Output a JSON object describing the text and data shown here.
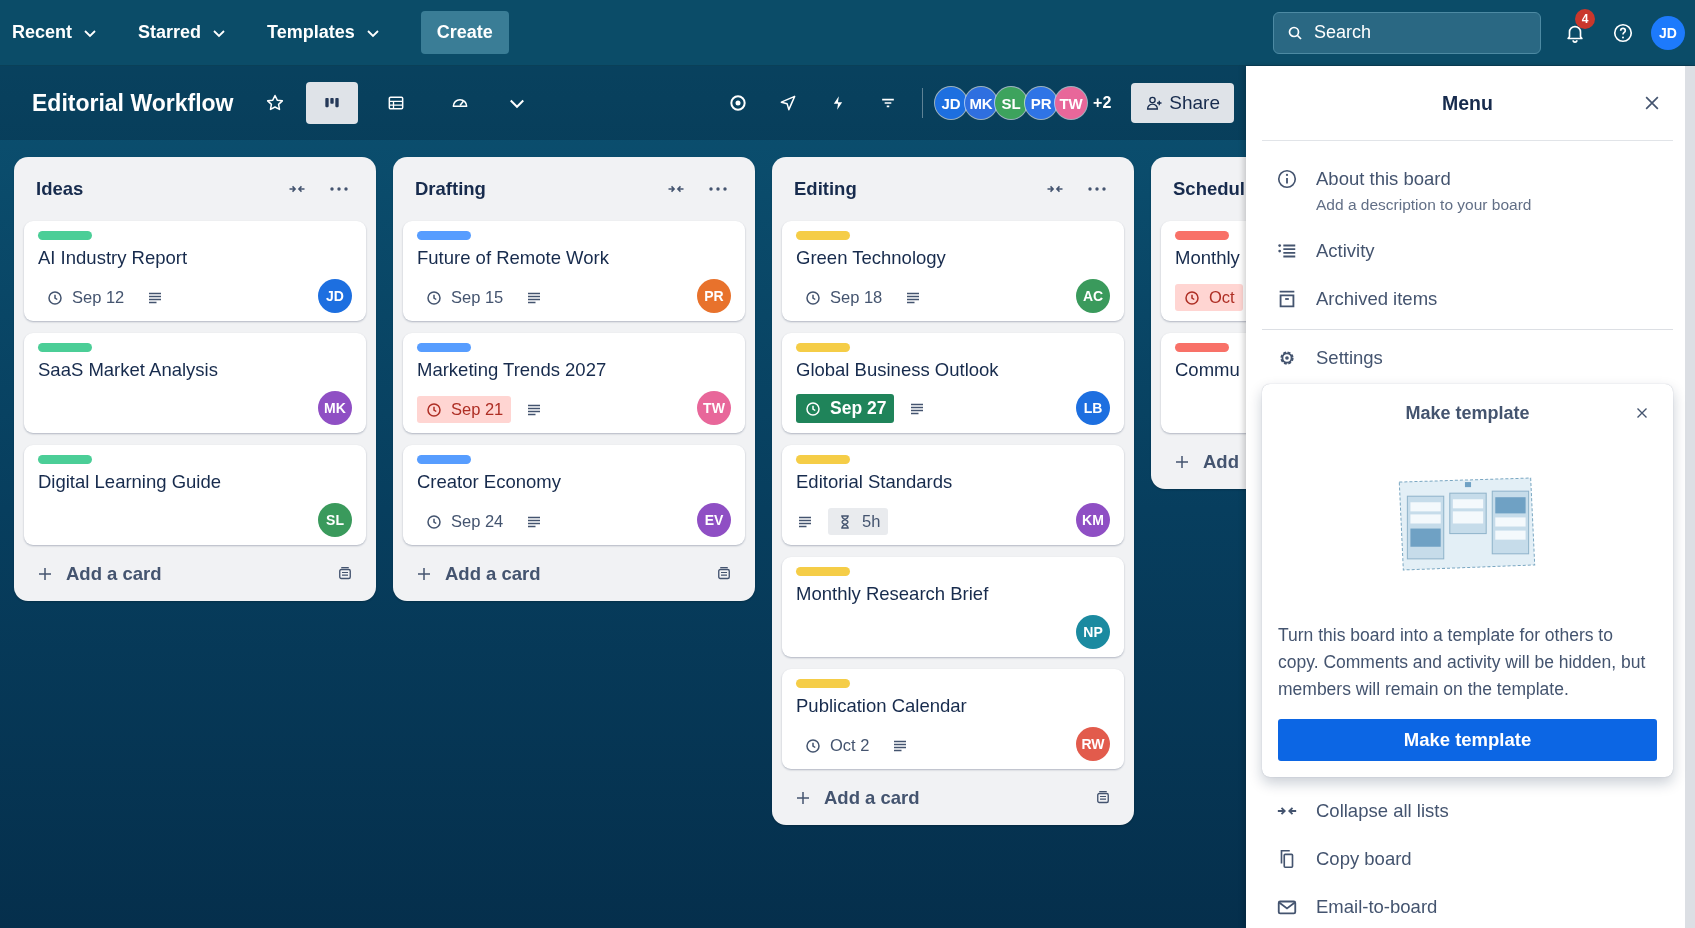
{
  "top_nav": {
    "menus": [
      {
        "label": "Recent"
      },
      {
        "label": "Starred"
      },
      {
        "label": "Templates"
      }
    ],
    "create_button": "Create",
    "search": {
      "placeholder": "Search"
    },
    "notification_count": "4",
    "account": {
      "initials": "JD",
      "color": "#1d7afc"
    }
  },
  "board_header": {
    "title": "Editorial Workflow",
    "views": [
      {
        "kind": "board",
        "selected": true
      },
      {
        "kind": "table",
        "selected": false
      },
      {
        "kind": "dashboard",
        "selected": false
      }
    ],
    "members": [
      {
        "initials": "JD",
        "color": "#1d6fe0"
      },
      {
        "initials": "MK",
        "color": "#2f6fe0"
      },
      {
        "initials": "SL",
        "color": "#3da35d"
      },
      {
        "initials": "PR",
        "color": "#2f74e6"
      },
      {
        "initials": "TW",
        "color": "#e8679a"
      }
    ],
    "more_members": "+2",
    "share_button": "Share"
  },
  "lists": [
    {
      "title": "Ideas",
      "actions_visible": true,
      "add_card": "Add a card",
      "cards": [
        {
          "title": "AI Industry Report",
          "label": {
            "color": "#4bce97"
          },
          "badges": [
            {
              "kind": "due",
              "text": "Sep 12",
              "overdue": false,
              "complete": false
            },
            {
              "kind": "description"
            }
          ],
          "member": {
            "initials": "JD",
            "color": "#1d6fe0"
          }
        },
        {
          "title": "SaaS Market Analysis",
          "label": {
            "color": "#4bce97"
          },
          "member": {
            "initials": "MK",
            "color": "#8f4fc4"
          }
        },
        {
          "title": "Digital Learning Guide",
          "label": {
            "color": "#4bce97"
          },
          "member": {
            "initials": "SL",
            "color": "#3a9a5c"
          }
        }
      ]
    },
    {
      "title": "Drafting",
      "actions_visible": true,
      "add_card": "Add a card",
      "cards": [
        {
          "title": "Future of Remote Work",
          "label": {
            "color": "#579dff"
          },
          "badges": [
            {
              "kind": "due",
              "text": "Sep 15",
              "overdue": false,
              "complete": false
            },
            {
              "kind": "description"
            }
          ],
          "member": {
            "initials": "PR",
            "color": "#e8722c"
          }
        },
        {
          "title": "Marketing Trends 2027",
          "label": {
            "color": "#579dff"
          },
          "badges": [
            {
              "kind": "due",
              "text": "Sep 21",
              "overdue": true,
              "complete": false
            },
            {
              "kind": "description"
            }
          ],
          "member": {
            "initials": "TW",
            "color": "#e8679a"
          }
        },
        {
          "title": "Creator Economy",
          "label": {
            "color": "#579dff"
          },
          "badges": [
            {
              "kind": "due",
              "text": "Sep 24",
              "overdue": false,
              "complete": false
            },
            {
              "kind": "description"
            }
          ],
          "member": {
            "initials": "EV",
            "color": "#8f4fc4"
          }
        }
      ]
    },
    {
      "title": "Editing",
      "actions_visible": true,
      "add_card": "Add a card",
      "cards": [
        {
          "title": "Green Technology",
          "label": {
            "color": "#f5cd47"
          },
          "badges": [
            {
              "kind": "due",
              "text": "Sep 18",
              "overdue": false,
              "complete": false
            },
            {
              "kind": "description"
            }
          ],
          "member": {
            "initials": "AC",
            "color": "#3a9a5c"
          }
        },
        {
          "title": "Global Business Outlook",
          "label": {
            "color": "#f5cd47"
          },
          "badges": [
            {
              "kind": "due",
              "text": "Sep 27",
              "overdue": false,
              "complete": true
            },
            {
              "kind": "description"
            }
          ],
          "member": {
            "initials": "LB",
            "color": "#1d6fe0"
          }
        },
        {
          "title": "Editorial Standards",
          "label": {
            "color": "#f5cd47"
          },
          "badges": [
            {
              "kind": "description"
            },
            {
              "kind": "estimate",
              "text": "5h"
            }
          ],
          "member": {
            "initials": "KM",
            "color": "#8f4fc4"
          }
        },
        {
          "title": "Monthly Research Brief",
          "label": {
            "color": "#f5cd47"
          },
          "member": {
            "initials": "NP",
            "color": "#1b8aa0"
          }
        },
        {
          "title": "Publication Calendar",
          "label": {
            "color": "#f5cd47"
          },
          "badges": [
            {
              "kind": "due",
              "text": "Oct 2",
              "overdue": false,
              "complete": false
            },
            {
              "kind": "description"
            }
          ],
          "member": {
            "initials": "RW",
            "color": "#e25b4c"
          }
        }
      ]
    },
    {
      "title": "Schedul",
      "actions_visible": false,
      "add_card": "Add",
      "cards": [
        {
          "title": "Monthly",
          "label": {
            "color": "#f87168"
          },
          "badges": [
            {
              "kind": "due",
              "text": "Oct",
              "overdue": true,
              "complete": false
            }
          ]
        },
        {
          "title": "Commu",
          "label": {
            "color": "#f87168"
          }
        }
      ]
    }
  ],
  "menu": {
    "title": "Menu",
    "items": [
      {
        "kind": "about",
        "label": "About this board",
        "description": "Add a description to your board"
      },
      {
        "kind": "activity",
        "label": "Activity"
      },
      {
        "kind": "archive",
        "label": "Archived items"
      },
      {
        "kind": "settings",
        "label": "Settings"
      }
    ],
    "template_popover": {
      "title": "Make template",
      "text": "Turn this board into a template for others to copy. Comments and activity will be hidden, but members will remain on the template.",
      "button": "Make template"
    },
    "more_items": [
      {
        "kind": "collapse",
        "label": "Collapse all lists"
      },
      {
        "kind": "copy",
        "label": "Copy board"
      },
      {
        "kind": "email",
        "label": "Email-to-board"
      }
    ]
  }
}
